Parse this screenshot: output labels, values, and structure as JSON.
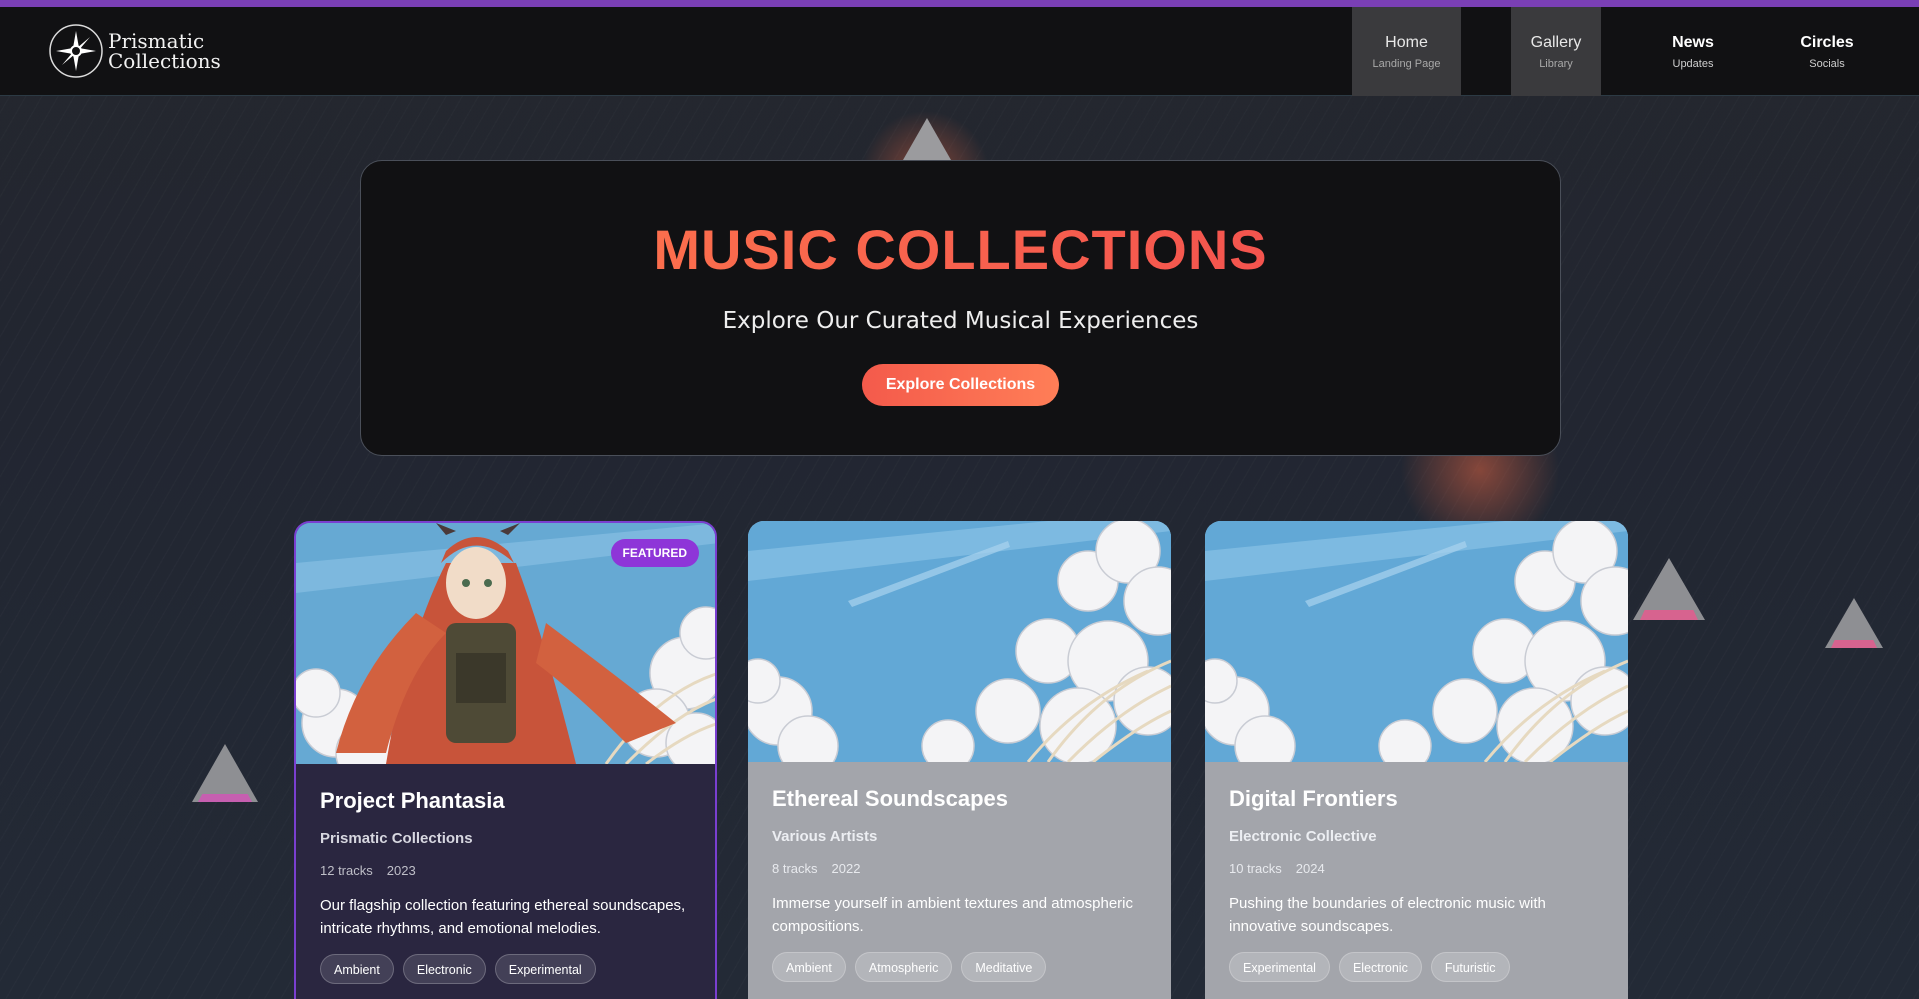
{
  "brand": {
    "name_line1": "Prismatic",
    "name_line2": "Collections"
  },
  "nav": [
    {
      "title": "Home",
      "subtitle": "Landing Page",
      "active": true
    },
    {
      "title": "Gallery",
      "subtitle": "Library",
      "active": true
    },
    {
      "title": "News",
      "subtitle": "Updates",
      "active": false
    },
    {
      "title": "Circles",
      "subtitle": "Socials",
      "active": false
    }
  ],
  "hero": {
    "title": "MUSIC COLLECTIONS",
    "subtitle": "Explore Our Curated Musical Experiences",
    "button": "Explore Collections"
  },
  "collections": [
    {
      "title": "Project Phantasia",
      "artist": "Prismatic Collections",
      "tracks": "12 tracks",
      "year": "2023",
      "description": "Our flagship collection featuring ethereal soundscapes, intricate rhythms, and emotional melodies.",
      "tags": [
        "Ambient",
        "Electronic",
        "Experimental"
      ],
      "badge": "FEATURED"
    },
    {
      "title": "Ethereal Soundscapes",
      "artist": "Various Artists",
      "tracks": "8 tracks",
      "year": "2022",
      "description": "Immerse yourself in ambient textures and atmospheric compositions.",
      "tags": [
        "Ambient",
        "Atmospheric",
        "Meditative"
      ]
    },
    {
      "title": "Digital Frontiers",
      "artist": "Electronic Collective",
      "tracks": "10 tracks",
      "year": "2024",
      "description": "Pushing the boundaries of electronic music with innovative soundscapes.",
      "tags": [
        "Experimental",
        "Electronic",
        "Futuristic"
      ]
    }
  ],
  "colors": {
    "accent_purple": "#7a3fb5",
    "hero_gradient_start": "#ff7a4c",
    "hero_gradient_end": "#f0484f",
    "badge": "#8e35d8"
  }
}
